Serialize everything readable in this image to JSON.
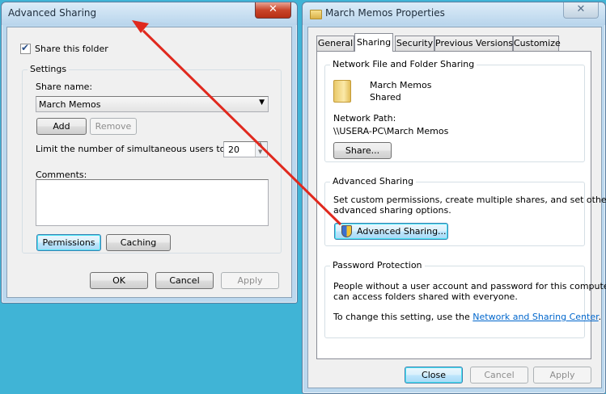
{
  "colors": {
    "desktop": "#40b4d6",
    "arrow": "#e0291e",
    "link": "#0066cc"
  },
  "advanced_sharing_dialog": {
    "title": "Advanced Sharing",
    "close_icon": "close-icon",
    "share_checkbox_label": "Share this folder",
    "share_checked": true,
    "settings_label": "Settings",
    "share_name_label": "Share name:",
    "share_name_value": "March Memos",
    "add_label": "Add",
    "remove_label": "Remove",
    "limit_label": "Limit the number of simultaneous users to:",
    "limit_value": "20",
    "comments_label": "Comments:",
    "comments_value": "",
    "permissions_label": "Permissions",
    "caching_label": "Caching",
    "ok_label": "OK",
    "cancel_label": "Cancel",
    "apply_label": "Apply"
  },
  "properties_dialog": {
    "title": "March Memos Properties",
    "folder_icon": "folder-icon",
    "close_icon": "close-icon",
    "tabs": [
      {
        "label": "General"
      },
      {
        "label": "Sharing",
        "active": true
      },
      {
        "label": "Security"
      },
      {
        "label": "Previous Versions"
      },
      {
        "label": "Customize"
      }
    ],
    "network_sharing": {
      "group_label": "Network File and Folder Sharing",
      "folder_name": "March Memos",
      "folder_status": "Shared",
      "network_path_label": "Network Path:",
      "network_path_value": "\\\\USERA-PC\\March Memos",
      "share_button_label": "Share..."
    },
    "advanced_sharing": {
      "group_label": "Advanced Sharing",
      "description_line1": "Set custom permissions, create multiple shares, and set other",
      "description_line2": "advanced sharing options.",
      "button_label": "Advanced Sharing...",
      "button_icon": "uac-shield-icon"
    },
    "password_protection": {
      "group_label": "Password Protection",
      "description_line1": "People without a user account and password for this computer",
      "description_line2": "can access folders shared with everyone.",
      "change_text": "To change this setting, use the ",
      "link_text": "Network and Sharing Center",
      "change_suffix": "."
    },
    "close_label": "Close",
    "cancel_label": "Cancel",
    "apply_label": "Apply"
  }
}
